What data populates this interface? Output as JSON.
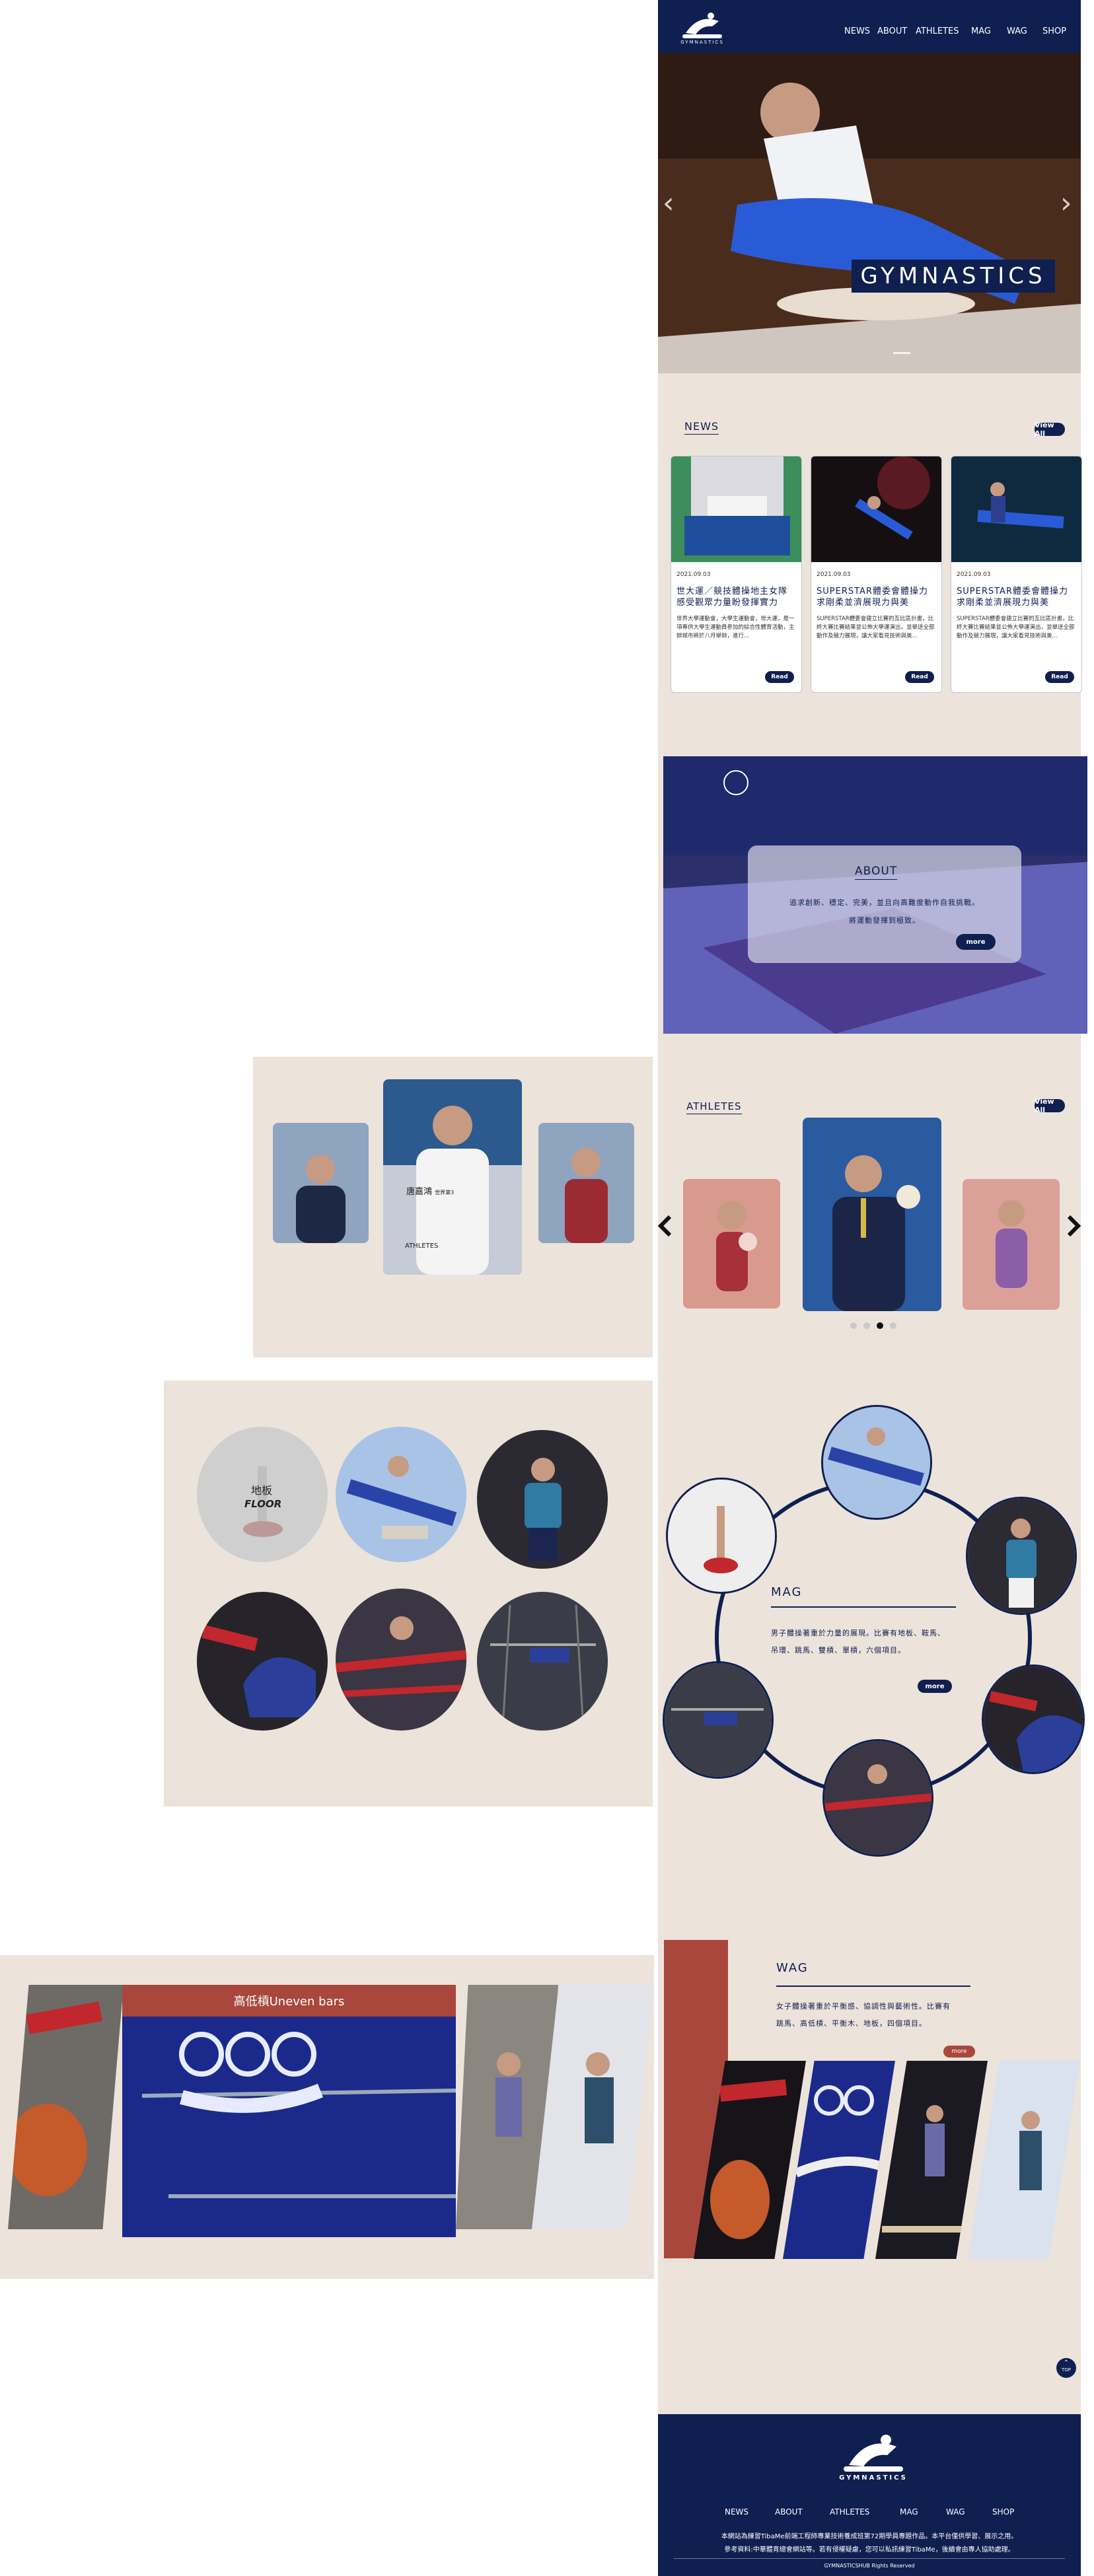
{
  "brand": {
    "logo_text": "GYMNASTICS"
  },
  "nav": {
    "items": [
      "NEWS",
      "ABOUT",
      "ATHLETES",
      "MAG",
      "WAG",
      "SHOP"
    ]
  },
  "hero": {
    "title": "GYMNASTICS",
    "prev_icon": "chevron-left-icon",
    "next_icon": "chevron-right-icon"
  },
  "news": {
    "heading": "NEWS",
    "view_all": "View All",
    "cards": [
      {
        "date": "2021.09.03",
        "title": "世大運／競技體操地主女隊感受觀眾力量盼發揮實力",
        "body": "世界大學運動會，大學生運動會，世大運，是一項專供大學生運動員參加的綜合性體育活動，主辦城市將於八月舉辦，進行...",
        "button": "Read"
      },
      {
        "date": "2021.09.03",
        "title": "SUPERSTAR體委會體操力求剛柔並濟展現力與美",
        "body": "SUPERSTAR體委會建立比賽的互比區計畫，比終大賽比賽結果並公佈大學運演出，並舉送全部動作及競力展現，讓大家看見技術與美...",
        "button": "Read"
      },
      {
        "date": "2021.09.03",
        "title": "SUPERSTAR體委會體操力求剛柔並濟展現力與美",
        "body": "SUPERSTAR體委會建立比賽的互比區計畫，比終大賽比賽結果並公佈大學運演出，並舉送全部動作及競力展現，讓大家看見技術與美...",
        "button": "Read"
      }
    ]
  },
  "about": {
    "heading": "ABOUT",
    "line1": "追求創新、穩定、完美，並且向高難度動作自我挑戰。",
    "line2": "將運動發揮到極致。",
    "button": "more"
  },
  "athletes_left": {
    "athlete_name": "唐嘉鴻",
    "athlete_tag": "世界第3",
    "caption": "ATHLETES"
  },
  "athletes": {
    "heading": "ATHLETES",
    "view_all": "View All",
    "dots": 4,
    "active_dot": 2
  },
  "events_left": {
    "label_cn": "地板",
    "label_en": "FLOOR"
  },
  "mag": {
    "heading": "MAG",
    "body_line1": "男子體操著重於力量的展現。比賽有地板、鞍馬、",
    "body_line2": "吊環、跳馬、雙槓、單槓，六個項目。",
    "button": "more"
  },
  "uneven": {
    "caption": "高低槓Uneven bars"
  },
  "wag": {
    "heading": "WAG",
    "body_line1": "女子體操著重於平衡感、協調性與藝術性。比賽有",
    "body_line2": "跳馬、高低槓、平衡木、地板，四個項目。",
    "button": "more"
  },
  "back_to_top": {
    "icon": "chevron-up-icon",
    "label": "TOP"
  },
  "footer": {
    "logo_text": "GYMNASTICS",
    "nav": [
      "NEWS",
      "ABOUT",
      "ATHLETES",
      "MAG",
      "WAG",
      "SHOP"
    ],
    "line1": "本網站為練習TibaMe前端工程師專業技術養成班第72期學員專題作品。本平台僅供學習、展示之用。",
    "line2": "參考資料:中華體育總會網站等。若有侵權疑慮，您可以私訊練習TibaMe，後續會由專人協助處理。",
    "copyright": "GYMNASTICSHUB Rights Reserved"
  },
  "colors": {
    "navy": "#0f1f50",
    "beige": "#ece3da",
    "red": "#a9473c",
    "accent_blue": "#3d5dbf"
  }
}
